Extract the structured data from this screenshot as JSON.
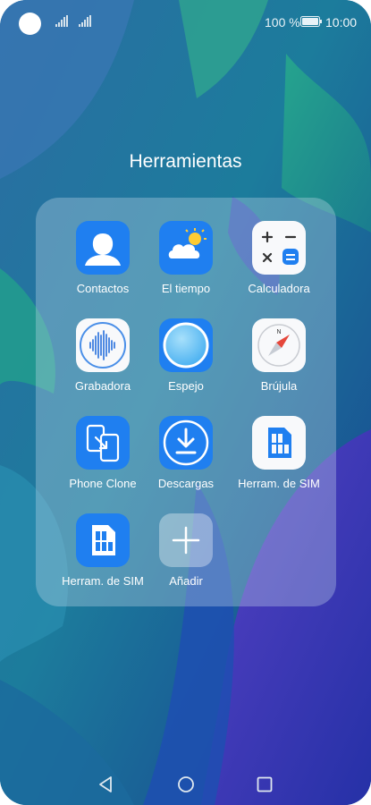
{
  "status_bar": {
    "battery": "100 %",
    "time": "10:00",
    "icons": [
      "camera-cutout",
      "signal-icon",
      "signal-icon",
      "battery-icon"
    ]
  },
  "folder": {
    "title": "Herramientas",
    "apps": [
      {
        "label": "Contactos",
        "icon": "contacts-icon"
      },
      {
        "label": "El tiempo",
        "icon": "weather-icon"
      },
      {
        "label": "Calculadora",
        "icon": "calculator-icon"
      },
      {
        "label": "Grabadora",
        "icon": "recorder-icon"
      },
      {
        "label": "Espejo",
        "icon": "mirror-icon"
      },
      {
        "label": "Brújula",
        "icon": "compass-icon"
      },
      {
        "label": "Phone Clone",
        "icon": "phone-clone-icon"
      },
      {
        "label": "Descargas",
        "icon": "download-icon"
      },
      {
        "label": "Herram. de SIM",
        "icon": "sim-icon"
      },
      {
        "label": "Herram. de SIM",
        "icon": "sim-icon"
      },
      {
        "label": "Añadir",
        "icon": "add-icon"
      }
    ]
  },
  "nav_bar": {
    "icons": [
      "back-icon",
      "home-icon",
      "recents-icon"
    ]
  },
  "colors": {
    "app_blue": "#1f7ff0",
    "app_white": "#f8f9fb",
    "add_tile": "rgba(255,255,255,0.35)"
  }
}
